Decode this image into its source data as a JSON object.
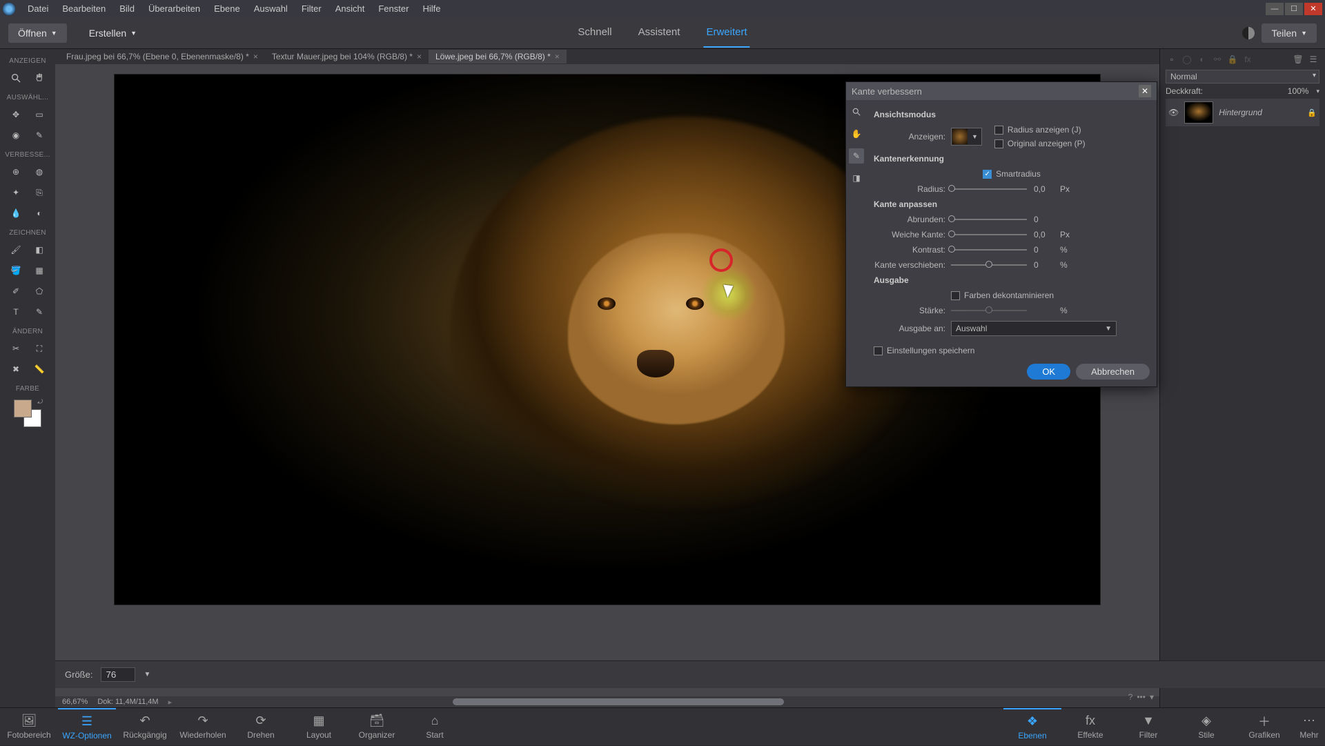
{
  "menubar": [
    "Datei",
    "Bearbeiten",
    "Bild",
    "Überarbeiten",
    "Ebene",
    "Auswahl",
    "Filter",
    "Ansicht",
    "Fenster",
    "Hilfe"
  ],
  "toolbar": {
    "open": "Öffnen",
    "create": "Erstellen",
    "share": "Teilen"
  },
  "modes": {
    "quick": "Schnell",
    "guided": "Assistent",
    "expert": "Erweitert"
  },
  "tool_sections": {
    "show": "ANZEIGEN",
    "select": "AUSWÄHL...",
    "enhance": "VERBESSE...",
    "draw": "ZEICHNEN",
    "modify": "ÄNDERN",
    "color": "FARBE"
  },
  "doc_tabs": [
    {
      "label": "Frau.jpeg bei 66,7% (Ebene 0, Ebenenmaske/8) *"
    },
    {
      "label": "Textur Mauer.jpeg bei 104% (RGB/8) *"
    },
    {
      "label": "Löwe.jpeg bei 66,7% (RGB/8) *"
    }
  ],
  "status": {
    "zoom": "66,67%",
    "doc": "Dok: 11,4M/11,4M"
  },
  "right_panel": {
    "blend": "Normal",
    "opacity_label": "Deckkraft:",
    "opacity": "100%",
    "layer_name": "Hintergrund"
  },
  "dialog": {
    "title": "Kante verbessern",
    "view_mode": "Ansichtsmodus",
    "show_label": "Anzeigen:",
    "show_radius": "Radius anzeigen (J)",
    "show_original": "Original anzeigen (P)",
    "edge_detect": "Kantenerkennung",
    "smart_radius": "Smartradius",
    "radius": "Radius:",
    "radius_val": "0,0",
    "px": "Px",
    "adjust": "Kante anpassen",
    "smooth": "Abrunden:",
    "smooth_val": "0",
    "feather": "Weiche Kante:",
    "feather_val": "0,0",
    "contrast": "Kontrast:",
    "contrast_val": "0",
    "pct": "%",
    "shift": "Kante verschieben:",
    "shift_val": "0",
    "output": "Ausgabe",
    "decontaminate": "Farben dekontaminieren",
    "amount": "Stärke:",
    "output_to": "Ausgabe an:",
    "output_sel": "Auswahl",
    "remember": "Einstellungen speichern",
    "ok": "OK",
    "cancel": "Abbrechen"
  },
  "options": {
    "size_label": "Größe:",
    "size_val": "76"
  },
  "bottom_left": [
    {
      "id": "photo-bin",
      "label": "Fotobereich"
    },
    {
      "id": "tool-options",
      "label": "WZ-Optionen"
    },
    {
      "id": "undo",
      "label": "Rückgängig"
    },
    {
      "id": "redo",
      "label": "Wiederholen"
    },
    {
      "id": "rotate",
      "label": "Drehen"
    },
    {
      "id": "layout",
      "label": "Layout"
    },
    {
      "id": "organizer",
      "label": "Organizer"
    },
    {
      "id": "home",
      "label": "Start"
    }
  ],
  "bottom_right": [
    {
      "id": "layers",
      "label": "Ebenen"
    },
    {
      "id": "effects",
      "label": "Effekte"
    },
    {
      "id": "filters",
      "label": "Filter"
    },
    {
      "id": "styles",
      "label": "Stile"
    },
    {
      "id": "graphics",
      "label": "Grafiken"
    },
    {
      "id": "more",
      "label": "Mehr"
    }
  ]
}
